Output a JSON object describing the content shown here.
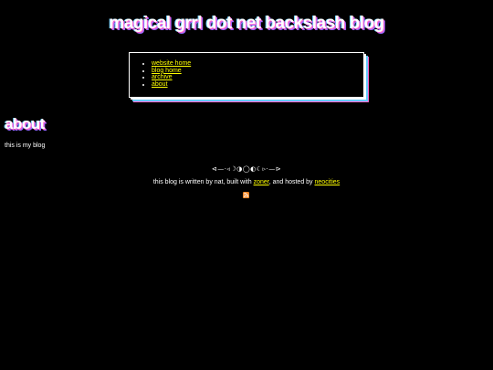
{
  "header": {
    "site_title": "magical grrl dot net backslash blog"
  },
  "nav": {
    "items": [
      {
        "label": "website home"
      },
      {
        "label": "blog home"
      },
      {
        "label": "archive"
      },
      {
        "label": "about"
      }
    ]
  },
  "post": {
    "title": "about",
    "body": "this is my blog"
  },
  "footer": {
    "divider": "⊲—·◃☽◑◯◐☾▹·—⊳",
    "credit_prefix": "this blog is written by nat, built with ",
    "zoner_link": "zoner",
    "credit_middle": ", and hosted by ",
    "neocities_link": "neocities",
    "rss_icon": "rss-feed-icon"
  },
  "colors": {
    "background": "#000000",
    "text": "#ffffff",
    "link": "#ffff00",
    "accent_pink": "#ff66cc",
    "accent_purple": "#9966ff",
    "accent_blue": "#66ccff",
    "rss_orange": "#f78422"
  }
}
